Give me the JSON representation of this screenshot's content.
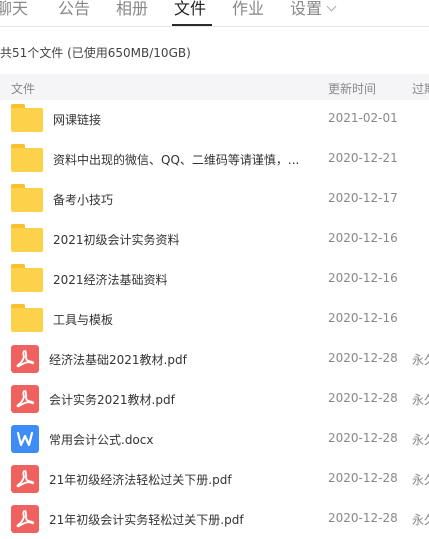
{
  "tabs": [
    {
      "label": "聊天"
    },
    {
      "label": "公告"
    },
    {
      "label": "相册"
    },
    {
      "label": "文件"
    },
    {
      "label": "作业"
    },
    {
      "label": "设置"
    }
  ],
  "active_tab": "文件",
  "summary": "共51个文件 (已使用650MB/10GB)",
  "table": {
    "headers": {
      "name": "文件",
      "updated": "更新时间",
      "expiry": "过期"
    },
    "rows": [
      {
        "name": "网课链接",
        "updated": "2021-02-01",
        "expiry": "",
        "type": "folder"
      },
      {
        "name": "资料中出现的微信、QQ、二维码等请谨慎，...",
        "updated": "2020-12-21",
        "expiry": "",
        "type": "folder"
      },
      {
        "name": "备考小技巧",
        "updated": "2020-12-17",
        "expiry": "",
        "type": "folder"
      },
      {
        "name": "2021初级会计实务资料",
        "updated": "2020-12-16",
        "expiry": "",
        "type": "folder"
      },
      {
        "name": "2021经济法基础资料",
        "updated": "2020-12-16",
        "expiry": "",
        "type": "folder"
      },
      {
        "name": "工具与模板",
        "updated": "2020-12-16",
        "expiry": "",
        "type": "folder"
      },
      {
        "name": "经济法基础2021教材.pdf",
        "updated": "2020-12-28",
        "expiry": "永久",
        "type": "pdf"
      },
      {
        "name": "会计实务2021教材.pdf",
        "updated": "2020-12-28",
        "expiry": "永久",
        "type": "pdf"
      },
      {
        "name": "常用会计公式.docx",
        "updated": "2020-12-28",
        "expiry": "永久",
        "type": "doc"
      },
      {
        "name": "21年初级经济法轻松过关下册.pdf",
        "updated": "2020-12-28",
        "expiry": "永久",
        "type": "pdf"
      },
      {
        "name": "21年初级会计实务轻松过关下册.pdf",
        "updated": "2020-12-28",
        "expiry": "永久",
        "type": "pdf"
      }
    ]
  },
  "colors": {
    "folder": "#fdd24a",
    "pdf": "#f0625f",
    "doc": "#3d8df5",
    "header_bg": "#f5f5f7"
  },
  "icons": {
    "folder": "folder-icon",
    "pdf": "pdf-icon",
    "doc": "word-doc-icon",
    "dropdown": "chevron-down-icon"
  }
}
